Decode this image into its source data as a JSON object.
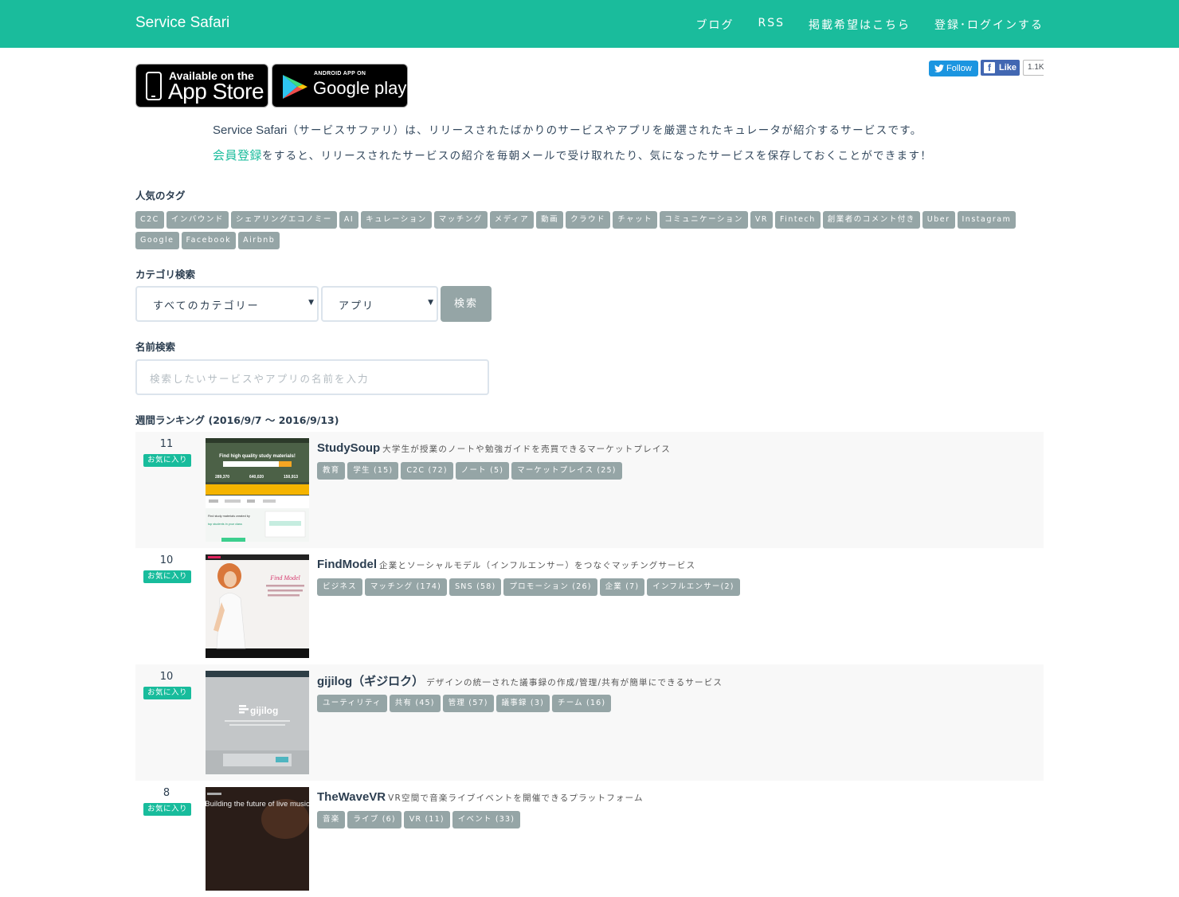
{
  "header": {
    "brand": "Service Safari",
    "nav": [
      "ブログ",
      "RSS",
      "掲載希望はこちら",
      "登録･ログインする"
    ]
  },
  "badges": {
    "appstore_line1": "Available on the",
    "appstore_line2": "App Store",
    "gplay_line1": "ANDROID APP ON",
    "gplay_line2": "Google play"
  },
  "social": {
    "twitter": "Follow",
    "facebook": "Like",
    "facebook_count": "1.1K"
  },
  "intro": {
    "brand": "Service Safari",
    "line1_rest": "（サービスサファリ）は、リリースされたばかりのサービスやアプリを厳選されたキュレータが紹介するサービスです。",
    "signup_link": "会員登録",
    "line2_rest": "をすると、リリースされたサービスの紹介を毎朝メールで受け取れたり、気になったサービスを保存しておくことができます！"
  },
  "popular_tags": {
    "title": "人気のタグ",
    "tags": [
      "C2C",
      "インバウンド",
      "シェアリングエコノミー",
      "AI",
      "キュレーション",
      "マッチング",
      "メディア",
      "動画",
      "クラウド",
      "チャット",
      "コミュニケーション",
      "VR",
      "Fintech",
      "創業者のコメント付き",
      "Uber",
      "Instagram",
      "Google",
      "Facebook",
      "Airbnb"
    ]
  },
  "category_search": {
    "title": "カテゴリ検索",
    "category_value": "すべてのカテゴリー",
    "type_value": "アプリ",
    "button": "検索"
  },
  "name_search": {
    "title": "名前検索",
    "placeholder": "検索したいサービスやアプリの名前を入力"
  },
  "ranking": {
    "title": "週間ランキング (2016/9/7 〜 2016/9/13)",
    "fav_label": "お気に入り",
    "items": [
      {
        "votes": "11",
        "name": "StudySoup",
        "desc": "大学生が授業のノートや勉強ガイドを売買できるマーケットプレイス",
        "tags": [
          "教育",
          "学生 (15)",
          "C2C (72)",
          "ノート (5)",
          "マーケットプレイス (25)"
        ],
        "thumb_text": [
          "Find high quality study materials!",
          "289,370",
          "640,020",
          "150,913",
          "Find study materials created by",
          "top students in your class"
        ]
      },
      {
        "votes": "10",
        "name": "FindModel",
        "desc": "企業とソーシャルモデル（インフルエンサー）をつなぐマッチングサービス",
        "tags": [
          "ビジネス",
          "マッチング (174)",
          "SNS (58)",
          "プロモーション (26)",
          "企業 (7)",
          "インフルエンサー(2)"
        ],
        "thumb_text": [
          "Find Model"
        ]
      },
      {
        "votes": "10",
        "name": "gijilog（ギジロク）",
        "desc": "デザインの統一された議事録の作成/管理/共有が簡単にできるサービス",
        "tags": [
          "ユーティリティ",
          "共有 (45)",
          "管理 (57)",
          "議事録 (3)",
          "チーム (16)"
        ],
        "thumb_text": [
          "gijilog"
        ]
      },
      {
        "votes": "8",
        "name": "TheWaveVR",
        "desc": "VR空間で音楽ライブイベントを開催できるプラットフォーム",
        "tags": [
          "音楽",
          "ライブ (6)",
          "VR (11)",
          "イベント (33)"
        ],
        "thumb_text": [
          "Building the future of live music"
        ]
      }
    ]
  }
}
